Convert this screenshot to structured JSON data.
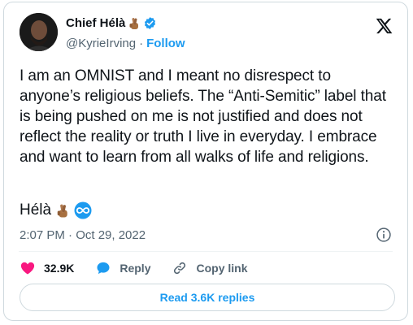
{
  "author": {
    "name": "Chief Hélà",
    "handle": "@KyrieIrving",
    "separator": "·",
    "follow_label": "Follow",
    "avatar_icon": "avatar-photo",
    "verified_icon": "verified-badge-icon",
    "emoji_icon": "fingers-crossed-emoji"
  },
  "tweet": {
    "text": "I am an OMNIST and I meant no disrespect to anyone’s religious beliefs. The “Anti-Semitic” label that is being pushed on me is not justified and does not reflect the reality or truth I live in everyday. I embrace and want to learn from all walks of life and religions.",
    "signature": "Hélà",
    "timestamp": "2:07 PM · Oct 29, 2022"
  },
  "actions": {
    "likes": "32.9K",
    "reply_label": "Reply",
    "copy_link_label": "Copy link"
  },
  "replies_button": "Read 3.6K replies",
  "colors": {
    "accent": "#1d9bf0",
    "like": "#f91880",
    "muted": "#536471",
    "border": "#cfd9de",
    "emoji_skin": "#b07a4f"
  }
}
